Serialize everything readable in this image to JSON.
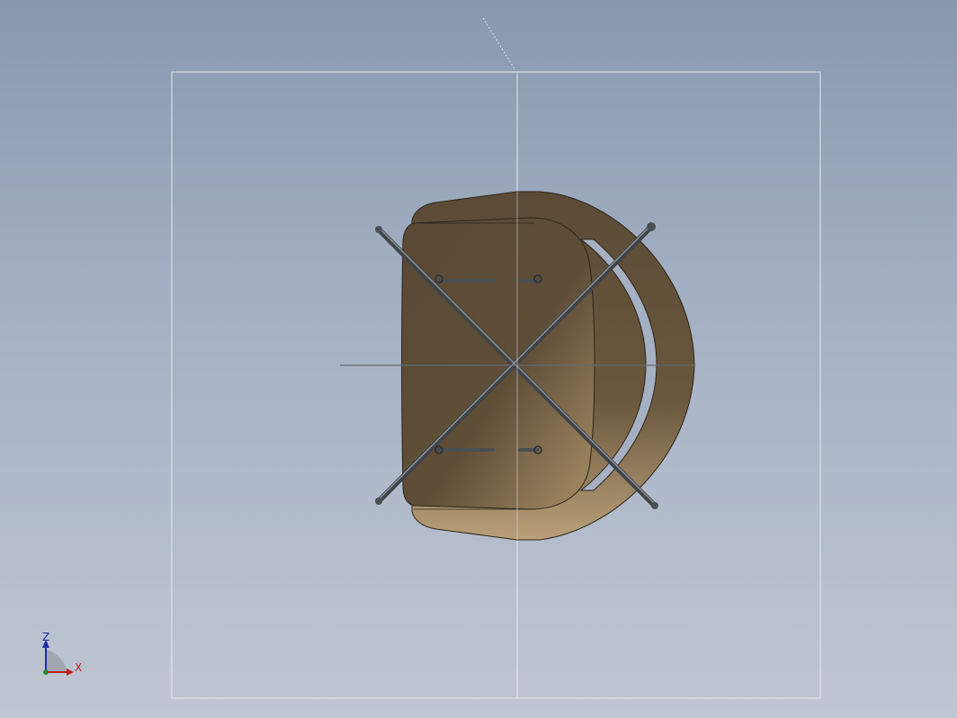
{
  "viewport": {
    "background_top": "#8898af",
    "background_bottom": "#c0c6d2",
    "model_name": "chair-top-view"
  },
  "colors": {
    "seat_dark": "#5a4a35",
    "seat_light": "#b39a72",
    "leg": "#4a4f54",
    "frame_line": "#e6e9ee",
    "axis_line": "#666a70"
  },
  "triad": {
    "z_label": "Z",
    "x_label": "X",
    "z_color": "#1a2ea8",
    "x_color": "#c0201a"
  }
}
